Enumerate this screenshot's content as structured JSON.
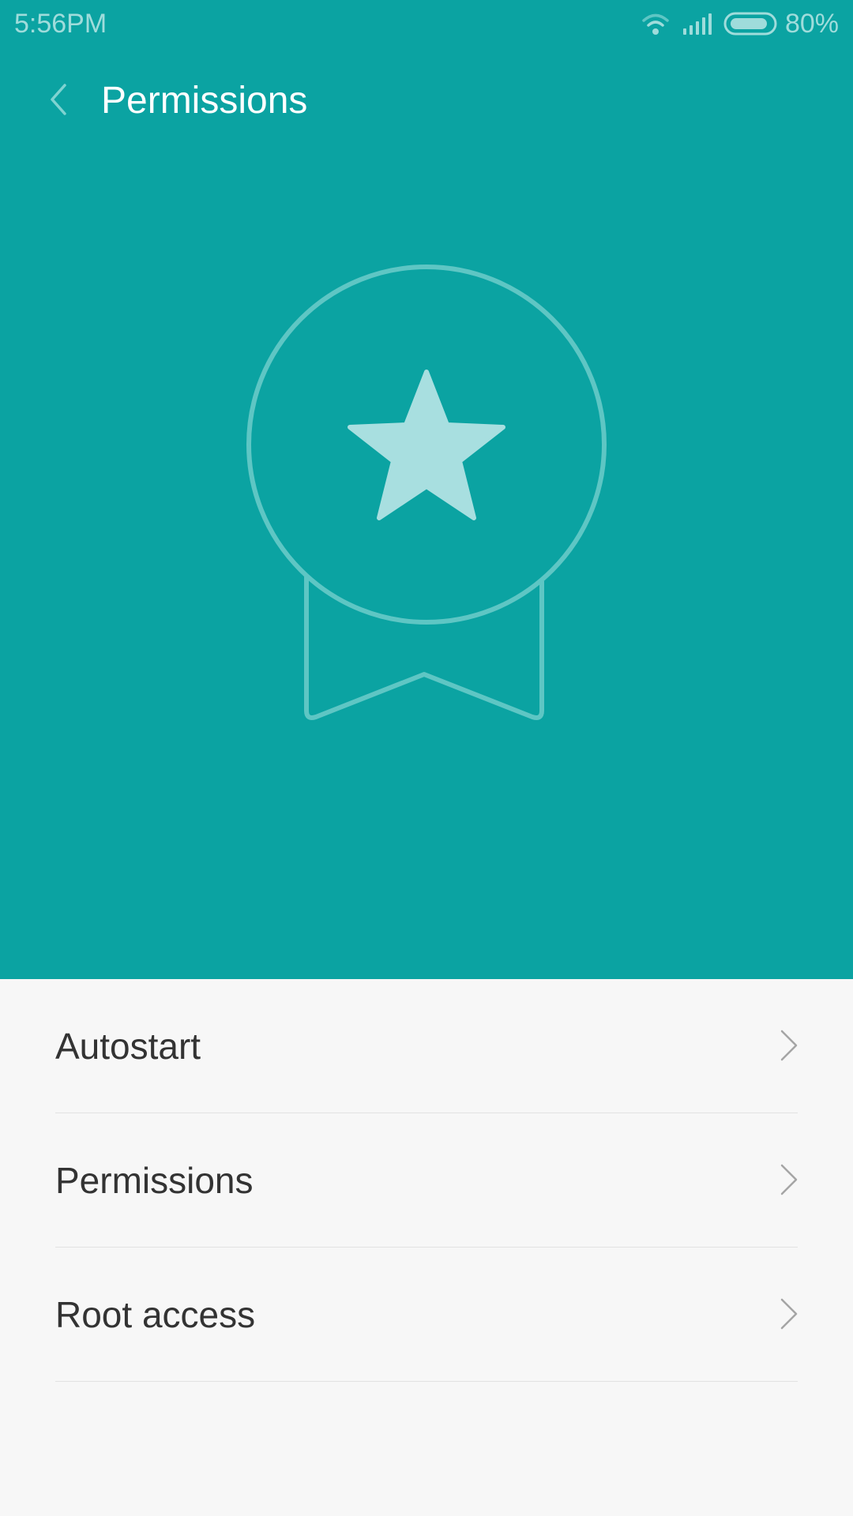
{
  "status_bar": {
    "time": "5:56PM",
    "battery_percent": "80%",
    "battery_level": 0.8,
    "icons": [
      "wifi-icon",
      "signal-icon",
      "battery-icon"
    ]
  },
  "header": {
    "title": "Permissions",
    "back_icon": "chevron-left-icon"
  },
  "hero": {
    "illustration": "medal-star-icon",
    "background_color": "#0ba3a2",
    "accent_color": "#5ec6c4",
    "star_color": "#a8dfe0"
  },
  "menu": {
    "items": [
      {
        "label": "Autostart",
        "icon": "chevron-right-icon"
      },
      {
        "label": "Permissions",
        "icon": "chevron-right-icon"
      },
      {
        "label": "Root access",
        "icon": "chevron-right-icon"
      }
    ]
  },
  "colors": {
    "list_background": "#f7f7f7",
    "text_primary": "#333333",
    "divider": "#e2e2e2"
  }
}
